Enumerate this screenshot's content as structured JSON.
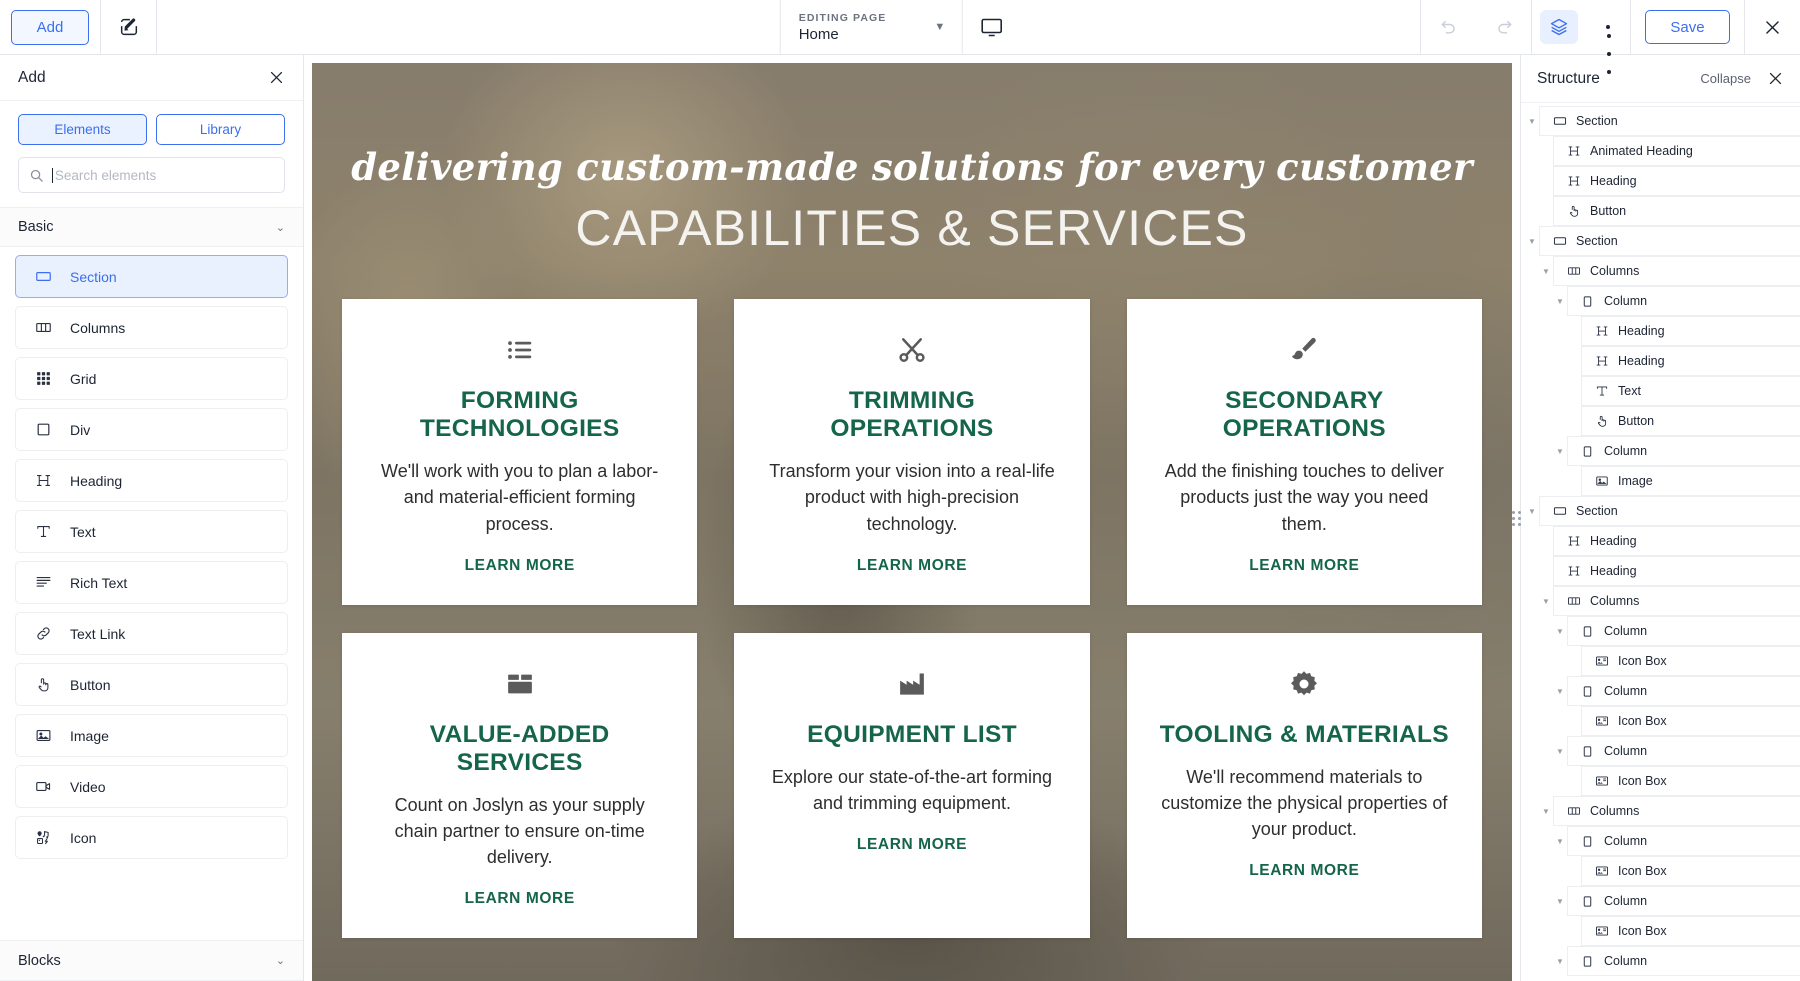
{
  "topbar": {
    "add_label": "Add",
    "edit_icon": "edit-square-icon",
    "editing_label": "EDITING PAGE",
    "page_name": "Home",
    "device_icon": "desktop-icon",
    "undo_icon": "undo-icon",
    "redo_icon": "redo-icon",
    "layers_icon": "layers-icon",
    "more_icon": "more-options-icon",
    "save_label": "Save",
    "close_icon": "close-icon",
    "accent_color": "#3b6ff0"
  },
  "add_panel": {
    "title": "Add",
    "close_icon": "close-icon",
    "tabs": [
      {
        "label": "Elements",
        "active": true
      },
      {
        "label": "Library",
        "active": false
      }
    ],
    "search": {
      "value": "",
      "placeholder": "Search elements",
      "icon": "search-icon"
    },
    "groups": [
      {
        "title": "Basic",
        "expanded": true,
        "chevron": "chevron-down-icon"
      },
      {
        "title": "Blocks",
        "expanded": false,
        "chevron": "chevron-down-icon"
      }
    ],
    "elements": [
      {
        "label": "Section",
        "icon": "section-icon",
        "selected": true
      },
      {
        "label": "Columns",
        "icon": "columns-icon",
        "selected": false
      },
      {
        "label": "Grid",
        "icon": "grid-icon",
        "selected": false
      },
      {
        "label": "Div",
        "icon": "div-icon",
        "selected": false
      },
      {
        "label": "Heading",
        "icon": "heading-icon",
        "selected": false
      },
      {
        "label": "Text",
        "icon": "text-icon",
        "selected": false
      },
      {
        "label": "Rich Text",
        "icon": "rich-text-icon",
        "selected": false
      },
      {
        "label": "Text Link",
        "icon": "link-icon",
        "selected": false
      },
      {
        "label": "Button",
        "icon": "button-icon",
        "selected": false
      },
      {
        "label": "Image",
        "icon": "image-icon",
        "selected": false
      },
      {
        "label": "Video",
        "icon": "video-icon",
        "selected": false
      },
      {
        "label": "Icon",
        "icon": "icon-icon",
        "selected": false
      }
    ]
  },
  "canvas": {
    "hero": {
      "subtitle": "delivering custom-made solutions for every customer",
      "title": "CAPABILITIES & SERVICES"
    },
    "card_title_color": "#15654a",
    "cards": [
      {
        "icon": "list-icon",
        "title": "FORMING TECHNOLOGIES",
        "text": "We'll work with you to plan a labor- and material-efficient forming process.",
        "link": "LEARN MORE"
      },
      {
        "icon": "scissors-icon",
        "title": "TRIMMING OPERATIONS",
        "text": "Transform your vision into a real-life product with high-precision technology.",
        "link": "LEARN MORE"
      },
      {
        "icon": "paintbrush-icon",
        "title": "SECONDARY OPERATIONS",
        "text": "Add the finishing touches to deliver products just the way you need them.",
        "link": "LEARN MORE"
      },
      {
        "icon": "box-icon",
        "title": "VALUE-ADDED SERVICES",
        "text": "Count on Joslyn as your supply chain partner to ensure on-time delivery.",
        "link": "LEARN MORE"
      },
      {
        "icon": "factory-icon",
        "title": "EQUIPMENT LIST",
        "text": "Explore our state-of-the-art forming and trimming equipment.",
        "link": "LEARN MORE"
      },
      {
        "icon": "gear-icon",
        "title": "TOOLING & MATERIALS",
        "text": "We'll recommend materials to customize the physical properties of your product.",
        "link": "LEARN MORE"
      }
    ],
    "drag_handle_icon": "resize-dots-icon"
  },
  "structure": {
    "title": "Structure",
    "collapse_label": "Collapse",
    "close_icon": "close-icon",
    "tree": [
      {
        "label": "Section",
        "icon": "section-icon",
        "depth": 0,
        "chevron": true
      },
      {
        "label": "Animated Heading",
        "icon": "heading-icon",
        "depth": 1,
        "chevron": false
      },
      {
        "label": "Heading",
        "icon": "heading-icon",
        "depth": 1,
        "chevron": false
      },
      {
        "label": "Button",
        "icon": "button-icon",
        "depth": 1,
        "chevron": false
      },
      {
        "label": "Section",
        "icon": "section-icon",
        "depth": 0,
        "chevron": true
      },
      {
        "label": "Columns",
        "icon": "columns-icon",
        "depth": 1,
        "chevron": true
      },
      {
        "label": "Column",
        "icon": "div-icon",
        "depth": 2,
        "chevron": true
      },
      {
        "label": "Heading",
        "icon": "heading-icon",
        "depth": 3,
        "chevron": false
      },
      {
        "label": "Heading",
        "icon": "heading-icon",
        "depth": 3,
        "chevron": false
      },
      {
        "label": "Text",
        "icon": "text-icon",
        "depth": 3,
        "chevron": false
      },
      {
        "label": "Button",
        "icon": "button-icon",
        "depth": 3,
        "chevron": false
      },
      {
        "label": "Column",
        "icon": "div-icon",
        "depth": 2,
        "chevron": true
      },
      {
        "label": "Image",
        "icon": "image-icon",
        "depth": 3,
        "chevron": false
      },
      {
        "label": "Section",
        "icon": "section-icon",
        "depth": 0,
        "chevron": true
      },
      {
        "label": "Heading",
        "icon": "heading-icon",
        "depth": 1,
        "chevron": false
      },
      {
        "label": "Heading",
        "icon": "heading-icon",
        "depth": 1,
        "chevron": false
      },
      {
        "label": "Columns",
        "icon": "columns-icon",
        "depth": 1,
        "chevron": true
      },
      {
        "label": "Column",
        "icon": "div-icon",
        "depth": 2,
        "chevron": true
      },
      {
        "label": "Icon Box",
        "icon": "icon-box-icon",
        "depth": 3,
        "chevron": false
      },
      {
        "label": "Column",
        "icon": "div-icon",
        "depth": 2,
        "chevron": true
      },
      {
        "label": "Icon Box",
        "icon": "icon-box-icon",
        "depth": 3,
        "chevron": false
      },
      {
        "label": "Column",
        "icon": "div-icon",
        "depth": 2,
        "chevron": true
      },
      {
        "label": "Icon Box",
        "icon": "icon-box-icon",
        "depth": 3,
        "chevron": false
      },
      {
        "label": "Columns",
        "icon": "columns-icon",
        "depth": 1,
        "chevron": true
      },
      {
        "label": "Column",
        "icon": "div-icon",
        "depth": 2,
        "chevron": true
      },
      {
        "label": "Icon Box",
        "icon": "icon-box-icon",
        "depth": 3,
        "chevron": false
      },
      {
        "label": "Column",
        "icon": "div-icon",
        "depth": 2,
        "chevron": true
      },
      {
        "label": "Icon Box",
        "icon": "icon-box-icon",
        "depth": 3,
        "chevron": false
      },
      {
        "label": "Column",
        "icon": "div-icon",
        "depth": 2,
        "chevron": true
      }
    ]
  }
}
